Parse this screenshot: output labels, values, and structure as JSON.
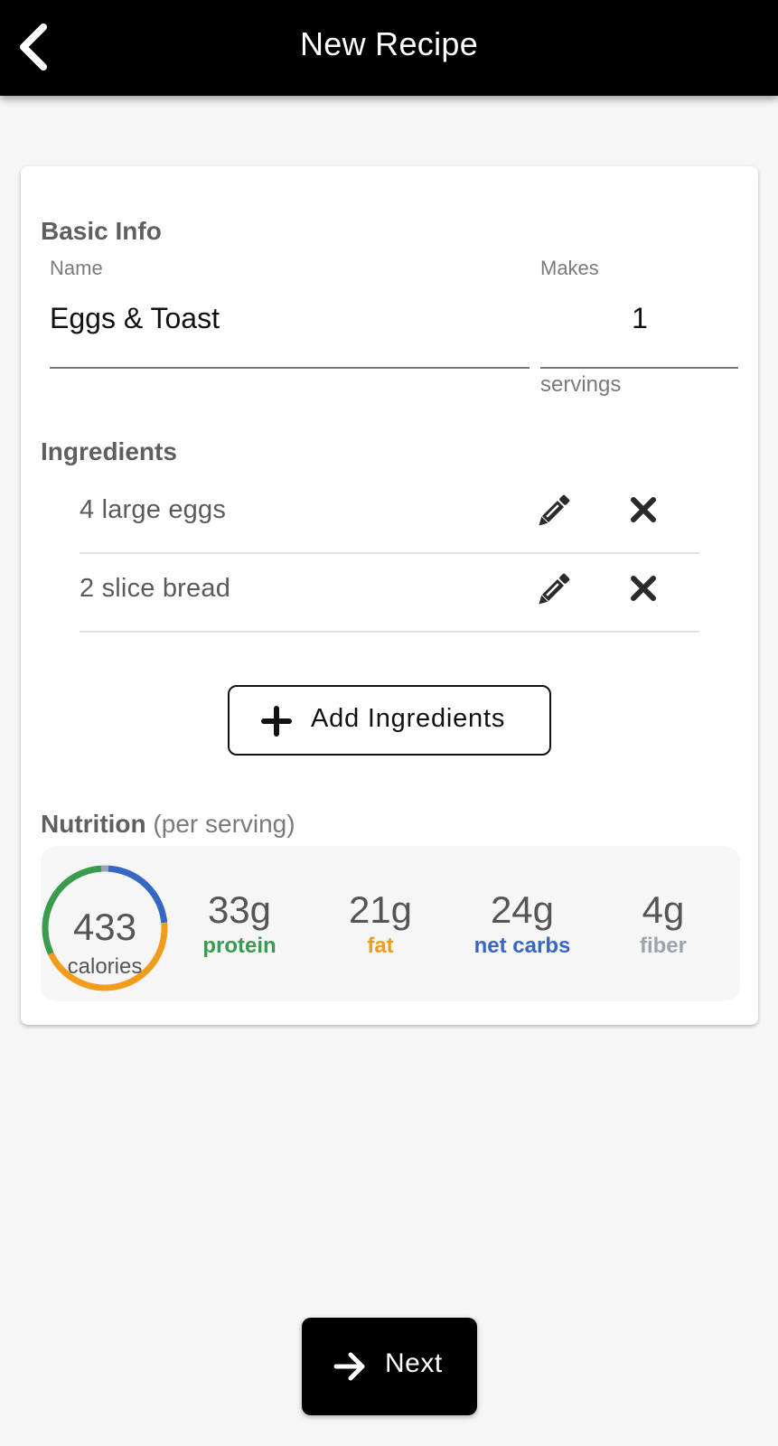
{
  "header": {
    "title": "New Recipe",
    "back_icon": "chevron-left-icon"
  },
  "basic_info": {
    "section_title": "Basic Info",
    "name_label": "Name",
    "name_value": "Eggs & Toast",
    "makes_label": "Makes",
    "makes_value": "1",
    "makes_unit": "servings"
  },
  "ingredients": {
    "section_title": "Ingredients",
    "items": [
      {
        "text": "4 large eggs",
        "edit_icon": "pencil-icon",
        "remove_icon": "close-icon"
      },
      {
        "text": "2 slice bread",
        "edit_icon": "pencil-icon",
        "remove_icon": "close-icon"
      }
    ],
    "add_button_label": "Add Ingredients",
    "add_icon": "plus-icon"
  },
  "nutrition": {
    "section_title": "Nutrition",
    "section_subtitle": "(per serving)",
    "calories": {
      "value": "433",
      "label": "calories"
    },
    "macros": [
      {
        "key": "protein",
        "value": "33g",
        "label": "protein",
        "color": "#3a9b4f",
        "grams": 33
      },
      {
        "key": "fat",
        "value": "21g",
        "label": "fat",
        "color": "#f29c1c",
        "grams": 21
      },
      {
        "key": "net_carbs",
        "value": "24g",
        "label": "net carbs",
        "color": "#3767c4",
        "grams": 24
      },
      {
        "key": "fiber",
        "value": "4g",
        "label": "fiber",
        "color": "#9ea3b0",
        "grams": 4
      }
    ]
  },
  "footer": {
    "next_label": "Next",
    "next_icon": "arrow-right-icon"
  }
}
